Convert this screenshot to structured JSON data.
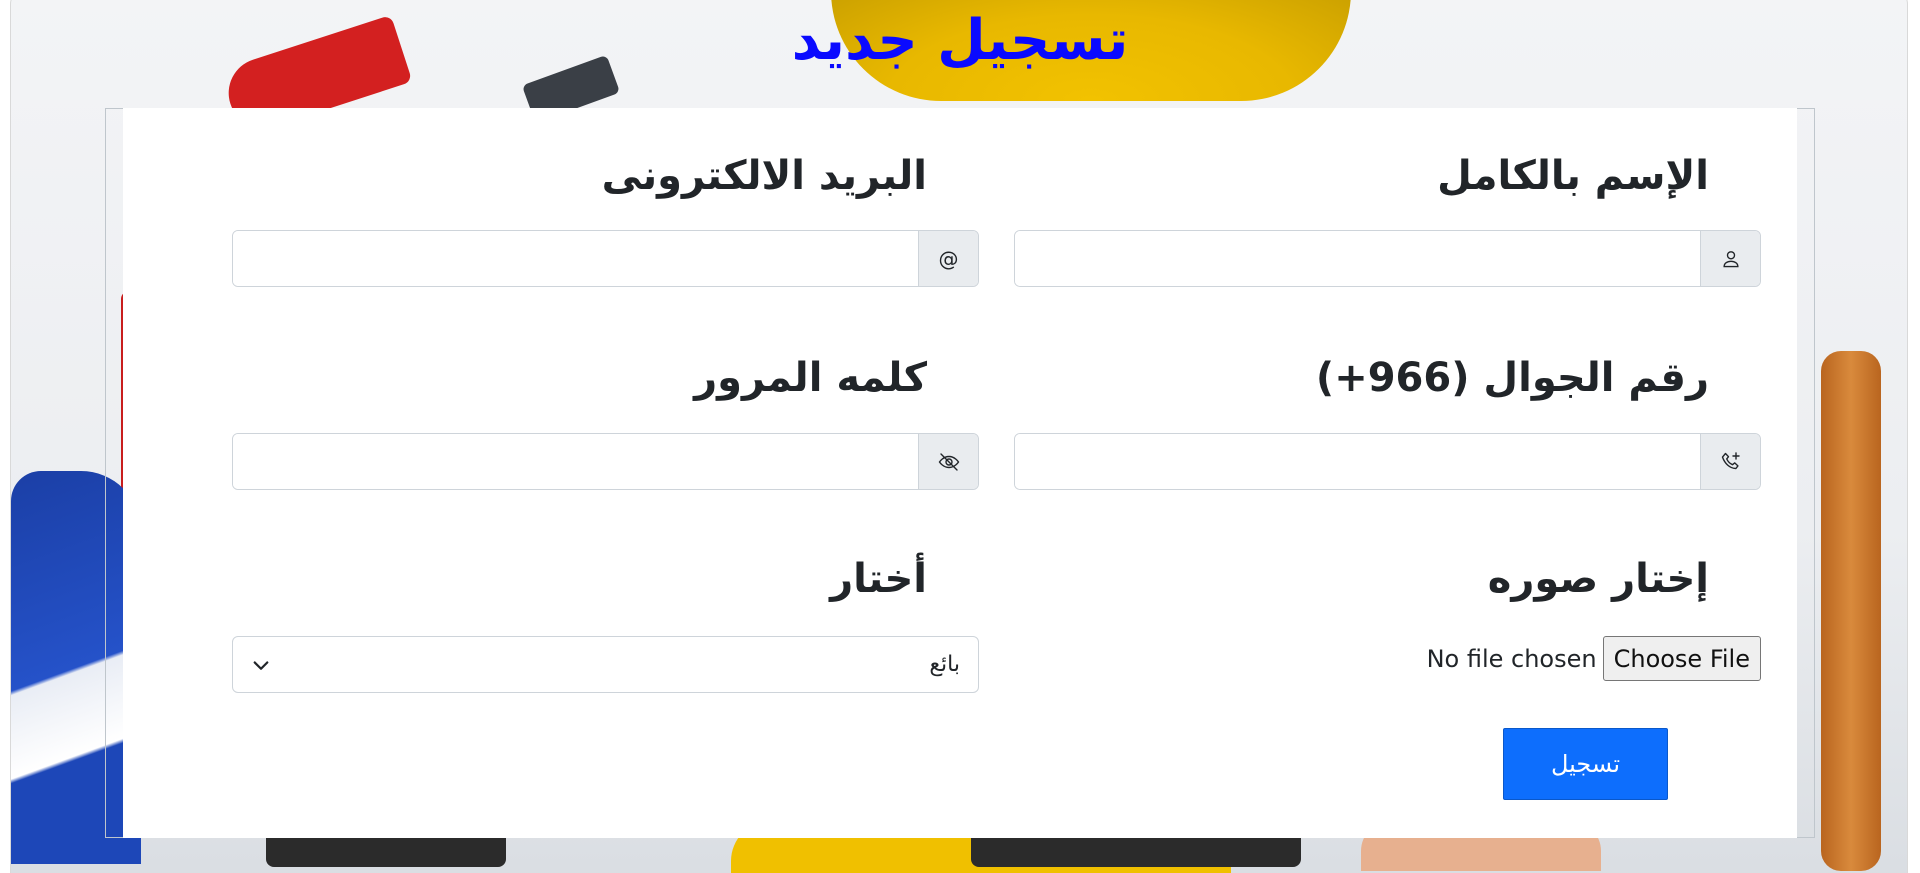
{
  "page": {
    "title": "تسجيل جديد"
  },
  "form": {
    "full_name": {
      "label": "الإسم بالكامل",
      "value": "",
      "icon": "person-icon"
    },
    "email": {
      "label": "البريد الالكترونى",
      "value": "",
      "icon": "at-sign-icon",
      "addon_text": "@"
    },
    "phone": {
      "label": "رقم الجوال (966+)",
      "value": "",
      "icon": "phone-plus-icon"
    },
    "password": {
      "label": "كلمه المرور",
      "value": "",
      "icon": "eye-slash-icon"
    },
    "photo": {
      "label": "إختار صوره",
      "button_label": "Choose File",
      "status": "No file chosen"
    },
    "role": {
      "label": "أختار",
      "selected": "بائع",
      "icon": "chevron-down-icon"
    },
    "submit_label": "تسجيل"
  },
  "colors": {
    "title": "#0a0aff",
    "primary_button": "#0d6efd",
    "addon_bg": "#e9ecef"
  }
}
